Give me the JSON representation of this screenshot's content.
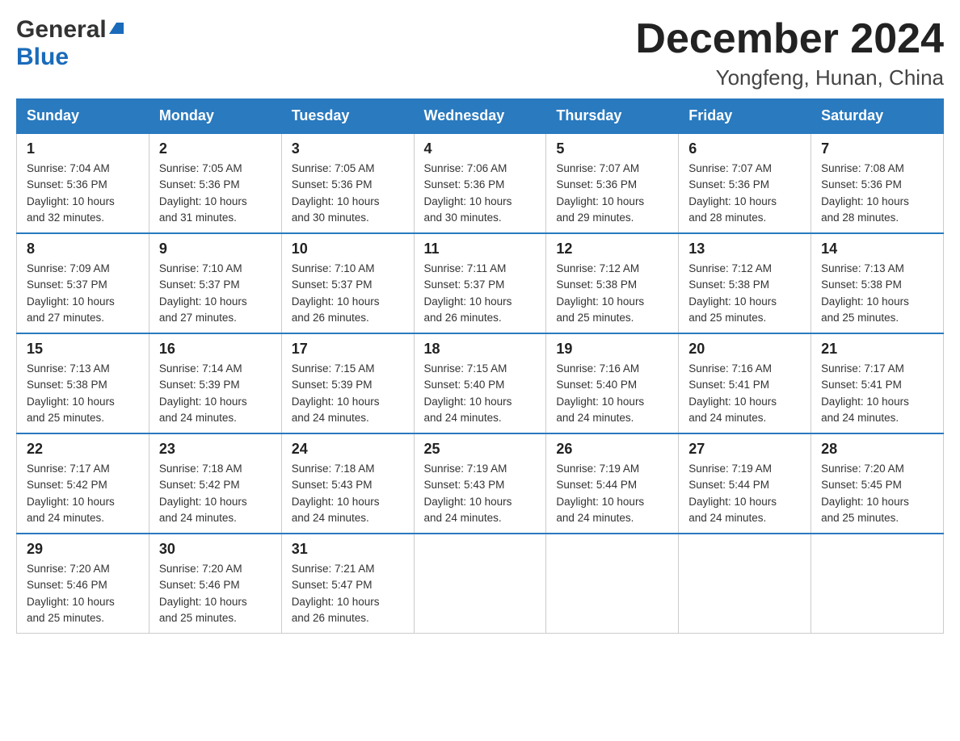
{
  "logo": {
    "general": "General",
    "blue": "Blue",
    "triangle": "▶"
  },
  "title": {
    "month": "December 2024",
    "location": "Yongfeng, Hunan, China"
  },
  "headers": [
    "Sunday",
    "Monday",
    "Tuesday",
    "Wednesday",
    "Thursday",
    "Friday",
    "Saturday"
  ],
  "weeks": [
    [
      {
        "day": "1",
        "sunrise": "7:04 AM",
        "sunset": "5:36 PM",
        "daylight": "10 hours and 32 minutes."
      },
      {
        "day": "2",
        "sunrise": "7:05 AM",
        "sunset": "5:36 PM",
        "daylight": "10 hours and 31 minutes."
      },
      {
        "day": "3",
        "sunrise": "7:05 AM",
        "sunset": "5:36 PM",
        "daylight": "10 hours and 30 minutes."
      },
      {
        "day": "4",
        "sunrise": "7:06 AM",
        "sunset": "5:36 PM",
        "daylight": "10 hours and 30 minutes."
      },
      {
        "day": "5",
        "sunrise": "7:07 AM",
        "sunset": "5:36 PM",
        "daylight": "10 hours and 29 minutes."
      },
      {
        "day": "6",
        "sunrise": "7:07 AM",
        "sunset": "5:36 PM",
        "daylight": "10 hours and 28 minutes."
      },
      {
        "day": "7",
        "sunrise": "7:08 AM",
        "sunset": "5:36 PM",
        "daylight": "10 hours and 28 minutes."
      }
    ],
    [
      {
        "day": "8",
        "sunrise": "7:09 AM",
        "sunset": "5:37 PM",
        "daylight": "10 hours and 27 minutes."
      },
      {
        "day": "9",
        "sunrise": "7:10 AM",
        "sunset": "5:37 PM",
        "daylight": "10 hours and 27 minutes."
      },
      {
        "day": "10",
        "sunrise": "7:10 AM",
        "sunset": "5:37 PM",
        "daylight": "10 hours and 26 minutes."
      },
      {
        "day": "11",
        "sunrise": "7:11 AM",
        "sunset": "5:37 PM",
        "daylight": "10 hours and 26 minutes."
      },
      {
        "day": "12",
        "sunrise": "7:12 AM",
        "sunset": "5:38 PM",
        "daylight": "10 hours and 25 minutes."
      },
      {
        "day": "13",
        "sunrise": "7:12 AM",
        "sunset": "5:38 PM",
        "daylight": "10 hours and 25 minutes."
      },
      {
        "day": "14",
        "sunrise": "7:13 AM",
        "sunset": "5:38 PM",
        "daylight": "10 hours and 25 minutes."
      }
    ],
    [
      {
        "day": "15",
        "sunrise": "7:13 AM",
        "sunset": "5:38 PM",
        "daylight": "10 hours and 25 minutes."
      },
      {
        "day": "16",
        "sunrise": "7:14 AM",
        "sunset": "5:39 PM",
        "daylight": "10 hours and 24 minutes."
      },
      {
        "day": "17",
        "sunrise": "7:15 AM",
        "sunset": "5:39 PM",
        "daylight": "10 hours and 24 minutes."
      },
      {
        "day": "18",
        "sunrise": "7:15 AM",
        "sunset": "5:40 PM",
        "daylight": "10 hours and 24 minutes."
      },
      {
        "day": "19",
        "sunrise": "7:16 AM",
        "sunset": "5:40 PM",
        "daylight": "10 hours and 24 minutes."
      },
      {
        "day": "20",
        "sunrise": "7:16 AM",
        "sunset": "5:41 PM",
        "daylight": "10 hours and 24 minutes."
      },
      {
        "day": "21",
        "sunrise": "7:17 AM",
        "sunset": "5:41 PM",
        "daylight": "10 hours and 24 minutes."
      }
    ],
    [
      {
        "day": "22",
        "sunrise": "7:17 AM",
        "sunset": "5:42 PM",
        "daylight": "10 hours and 24 minutes."
      },
      {
        "day": "23",
        "sunrise": "7:18 AM",
        "sunset": "5:42 PM",
        "daylight": "10 hours and 24 minutes."
      },
      {
        "day": "24",
        "sunrise": "7:18 AM",
        "sunset": "5:43 PM",
        "daylight": "10 hours and 24 minutes."
      },
      {
        "day": "25",
        "sunrise": "7:19 AM",
        "sunset": "5:43 PM",
        "daylight": "10 hours and 24 minutes."
      },
      {
        "day": "26",
        "sunrise": "7:19 AM",
        "sunset": "5:44 PM",
        "daylight": "10 hours and 24 minutes."
      },
      {
        "day": "27",
        "sunrise": "7:19 AM",
        "sunset": "5:44 PM",
        "daylight": "10 hours and 24 minutes."
      },
      {
        "day": "28",
        "sunrise": "7:20 AM",
        "sunset": "5:45 PM",
        "daylight": "10 hours and 25 minutes."
      }
    ],
    [
      {
        "day": "29",
        "sunrise": "7:20 AM",
        "sunset": "5:46 PM",
        "daylight": "10 hours and 25 minutes."
      },
      {
        "day": "30",
        "sunrise": "7:20 AM",
        "sunset": "5:46 PM",
        "daylight": "10 hours and 25 minutes."
      },
      {
        "day": "31",
        "sunrise": "7:21 AM",
        "sunset": "5:47 PM",
        "daylight": "10 hours and 26 minutes."
      },
      null,
      null,
      null,
      null
    ]
  ],
  "labels": {
    "sunrise": "Sunrise: ",
    "sunset": "Sunset: ",
    "daylight": "Daylight: "
  }
}
